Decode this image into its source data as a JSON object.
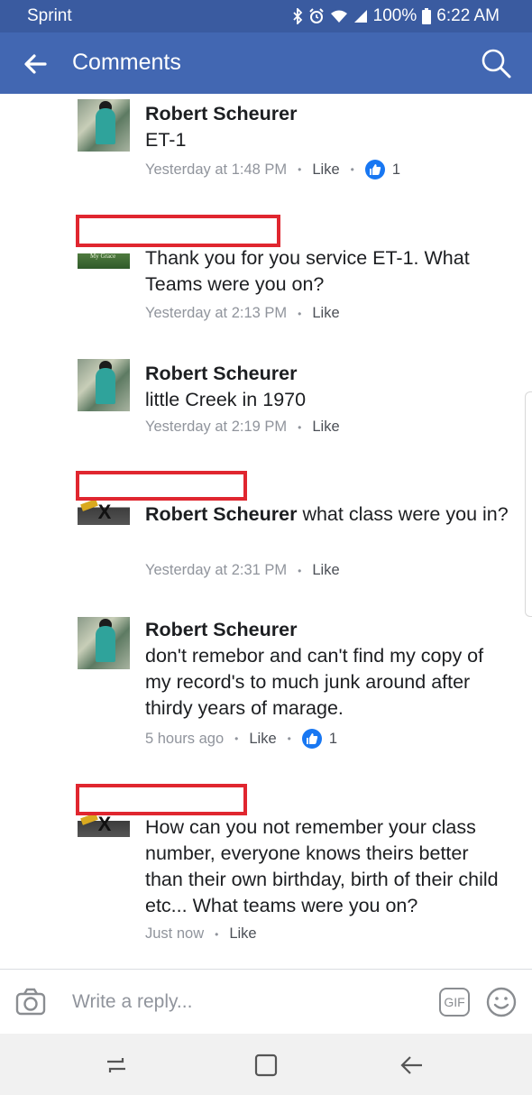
{
  "status_bar": {
    "carrier": "Sprint",
    "battery": "100%",
    "time": "6:22 AM"
  },
  "app_bar": {
    "title": "Comments"
  },
  "comments": [
    {
      "author": "Robert Scheurer",
      "text": "ET-1",
      "time": "Yesterday at 1:48 PM",
      "like": "Like",
      "reactions": "1",
      "avatar": "robert"
    },
    {
      "author": "",
      "text": "Thank you for you service ET-1. What Teams were you on?",
      "time": "Yesterday at 2:13 PM",
      "like": "Like",
      "avatar_label": "My Grace"
    },
    {
      "author": "Robert Scheurer",
      "text": "little Creek in 1970",
      "time": "Yesterday at 2:19 PM",
      "like": "Like"
    },
    {
      "author": "",
      "mention": "Robert Scheurer",
      "text": " what class were you in?",
      "time": "Yesterday at 2:31 PM",
      "like": "Like"
    },
    {
      "author": "Robert Scheurer",
      "text": "don't remebor and can't find my copy of my record's to much junk around after thirdy years of marage.",
      "time": "5 hours ago",
      "like": "Like",
      "reactions": "1"
    },
    {
      "author": "",
      "text": "How can you not remember your class number,  everyone knows theirs better than their own birthday, birth of their child etc...  What teams were you on?",
      "time": "Just now",
      "like": "Like"
    }
  ],
  "reply_bar": {
    "placeholder": "Write a reply...",
    "gif_label": "GIF"
  },
  "colors": {
    "status_bar": "#3a5ba0",
    "app_bar": "#4267b2",
    "redaction": "#e0262f",
    "like_badge": "#1877f2"
  }
}
